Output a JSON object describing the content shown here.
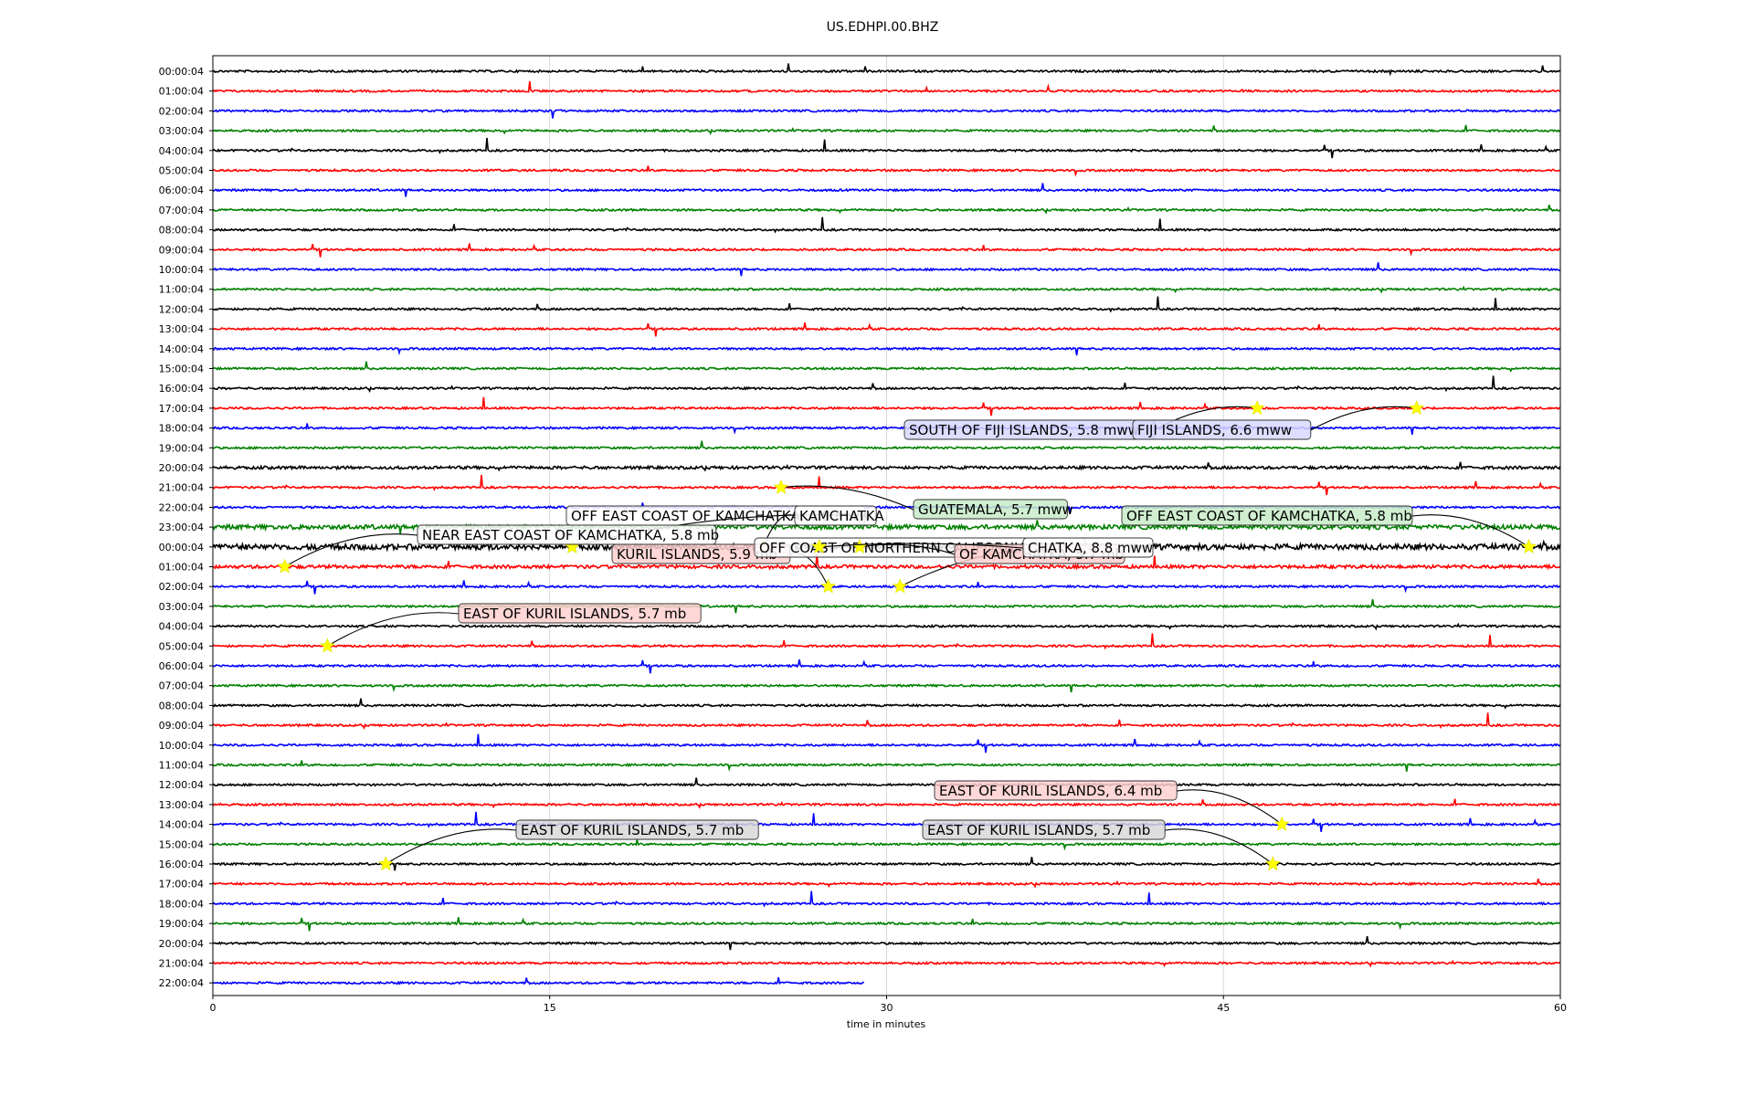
{
  "chart_data": {
    "type": "line",
    "title": "US.EDHPI.00.BHZ",
    "xlabel": "time in minutes",
    "ylabel": "",
    "xlim": [
      0,
      60
    ],
    "x_ticks": [
      0,
      15,
      30,
      45,
      60
    ],
    "grid": "vertical",
    "row_labels": [
      "00:00:04",
      "01:00:04",
      "02:00:04",
      "03:00:04",
      "04:00:04",
      "05:00:04",
      "06:00:04",
      "07:00:04",
      "08:00:04",
      "09:00:04",
      "10:00:04",
      "11:00:04",
      "12:00:04",
      "13:00:04",
      "14:00:04",
      "15:00:04",
      "16:00:04",
      "17:00:04",
      "18:00:04",
      "19:00:04",
      "20:00:04",
      "21:00:04",
      "22:00:04",
      "23:00:04",
      "00:00:04",
      "01:00:04",
      "02:00:04",
      "03:00:04",
      "04:00:04",
      "05:00:04",
      "06:00:04",
      "07:00:04",
      "08:00:04",
      "09:00:04",
      "10:00:04",
      "11:00:04",
      "12:00:04",
      "13:00:04",
      "14:00:04",
      "15:00:04",
      "16:00:04",
      "17:00:04",
      "18:00:04",
      "19:00:04",
      "20:00:04",
      "21:00:04",
      "22:00:04"
    ],
    "trace_colors": [
      "#000000",
      "#ff0000",
      "#0000ff",
      "#008000"
    ],
    "last_row_end_minute": 29,
    "marker_color": "#ffff00",
    "events": [
      {
        "label": "SOUTH OF FIJI ISLANDS, 5.8 mww",
        "row": 17,
        "minute": 46.5,
        "box_color": "#d8d8ff"
      },
      {
        "label": "FIJI ISLANDS, 6.6 mww",
        "row": 17,
        "minute": 53.6,
        "box_color": "#d8d8ff"
      },
      {
        "label": "GUATEMALA, 5.7 mww",
        "row": 21,
        "minute": 25.3,
        "box_color": "#c8ecc8"
      },
      {
        "label": "OFF EAST COAST OF KAMCHATKA, 5.8 mb",
        "row": 24,
        "minute": 58.6,
        "box_color": "#c8ecc8"
      },
      {
        "label": "OFF EAST COAST OF KAMCHATKA, 6.9 mww",
        "row": 24,
        "minute": 16.0,
        "box_color": "#ffffff"
      },
      {
        "label": "KAMCHATKA",
        "row": 24,
        "minute": 24.5,
        "box_color": "#ffffff"
      },
      {
        "label": "NEAR EAST COAST OF KAMCHATKA, 5.8 mb",
        "row": 25,
        "minute": 3.2,
        "box_color": "#ffffff"
      },
      {
        "label": "KURIL ISLANDS, 5.9 mb",
        "row": 26,
        "minute": 27.4,
        "box_color": "#ffd0d0"
      },
      {
        "label": "OFF COAST OF NORTHERN CALIFORNIA, 4.5 mw",
        "row": 26,
        "minute": 30.6,
        "box_color": "#ffffff"
      },
      {
        "label": "OF KAMCHATKA, 5.7 mb",
        "row": 24,
        "minute": 28.8,
        "box_color": "#ffd0d0"
      },
      {
        "label": "CHATKA, 8.8 mww",
        "row": 24,
        "minute": 27.0,
        "box_color": "#ffffff"
      },
      {
        "label": "EAST OF KURIL ISLANDS, 5.7 mb",
        "row": 29,
        "minute": 5.1,
        "box_color": "#ffd0d0"
      },
      {
        "label": "EAST OF KURIL ISLANDS, 6.4 mb",
        "row": 38,
        "minute": 47.6,
        "box_color": "#ffd0d0"
      },
      {
        "label": "EAST OF KURIL ISLANDS, 5.7 mb",
        "row": 40,
        "minute": 7.7,
        "box_color": "#d8d8d8"
      },
      {
        "label": "EAST OF KURIL ISLANDS, 5.7 mb",
        "row": 40,
        "minute": 47.2,
        "box_color": "#d8d8d8"
      }
    ]
  }
}
